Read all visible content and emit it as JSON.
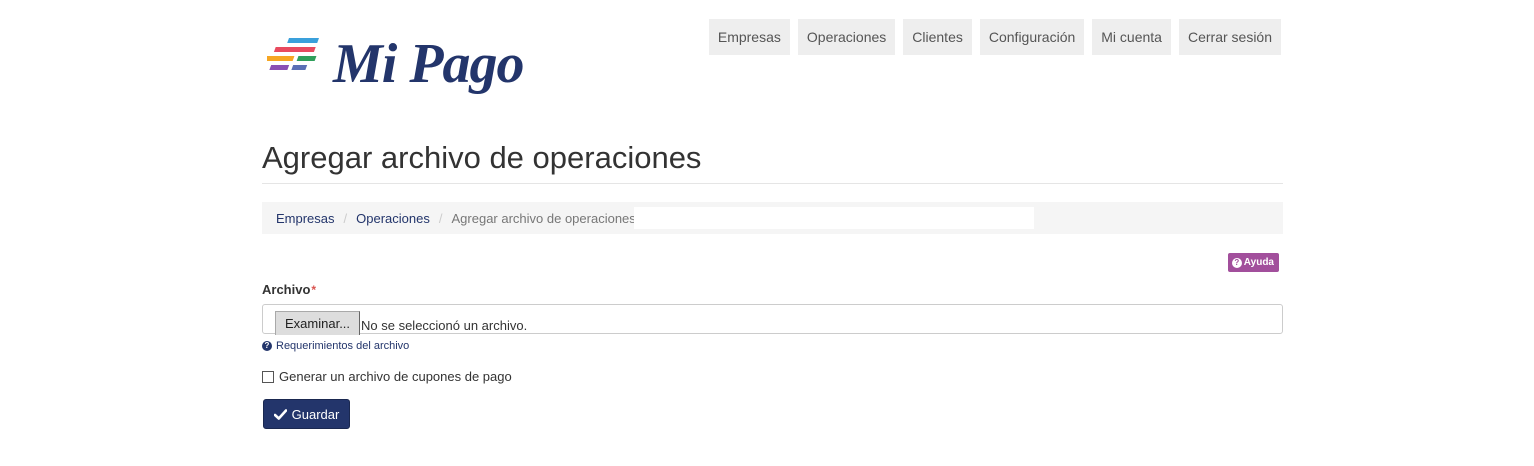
{
  "brand": {
    "name": "Mi Pago",
    "text_color": "#23356b"
  },
  "nav": {
    "items": [
      {
        "label": "Empresas"
      },
      {
        "label": "Operaciones"
      },
      {
        "label": "Clientes"
      },
      {
        "label": "Configuración"
      },
      {
        "label": "Mi cuenta"
      },
      {
        "label": "Cerrar sesión"
      }
    ]
  },
  "page": {
    "title": "Agregar archivo de operaciones"
  },
  "breadcrumb": {
    "items": [
      {
        "label": "Empresas"
      },
      {
        "label": "Operaciones"
      },
      {
        "label": "Agregar archivo de operaciones"
      }
    ],
    "separator": "/"
  },
  "help": {
    "label": "Ayuda",
    "icon": "question-circle-icon",
    "color": "#a24f9c"
  },
  "form": {
    "file_label": "Archivo",
    "required_mark": "*",
    "file_button": "Examinar...",
    "file_status": "No se seleccionó un archivo.",
    "requirements_link": "Requerimientos del archivo",
    "checkbox_label": "Generar un archivo de cupones de pago",
    "checkbox_checked": false,
    "save_label": "Guardar",
    "save_icon": "check-icon",
    "save_color": "#23356b"
  }
}
